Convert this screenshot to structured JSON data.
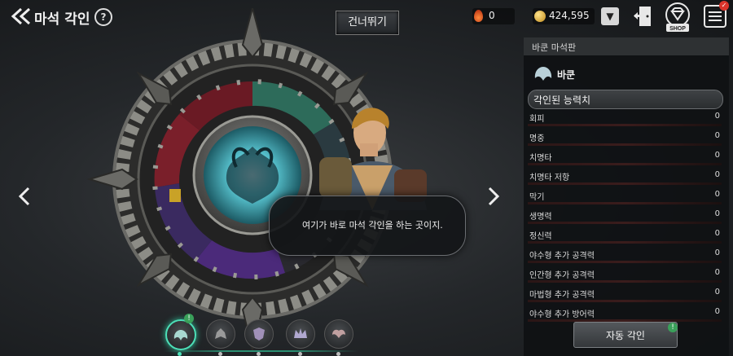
{
  "header": {
    "title": "마석 각인",
    "help_label": "?",
    "skip_label": "건너뛰기",
    "red_currency": "0",
    "gold_currency": "424,595",
    "dropdown_label": "▼",
    "shop_label": "SHOP",
    "menu_badge": "✓"
  },
  "dialog": {
    "text": "여기가 바로 마석 각인을 하는 곳이지."
  },
  "panel": {
    "title": "바쿤 마석판",
    "name": "바쿤",
    "section_title": "각인된 능력치",
    "stats": [
      {
        "label": "회피",
        "value": "0"
      },
      {
        "label": "명중",
        "value": "0"
      },
      {
        "label": "치명타",
        "value": "0"
      },
      {
        "label": "치명타 저항",
        "value": "0"
      },
      {
        "label": "막기",
        "value": "0"
      },
      {
        "label": "생명력",
        "value": "0"
      },
      {
        "label": "정신력",
        "value": "0"
      },
      {
        "label": "야수형 추가 공격력",
        "value": "0"
      },
      {
        "label": "인간형 추가 공격력",
        "value": "0"
      },
      {
        "label": "마법형 추가 공격력",
        "value": "0"
      },
      {
        "label": "야수형 추가 방어력",
        "value": "0"
      }
    ],
    "auto_label": "자동 각인",
    "auto_badge": "!"
  },
  "tabs": {
    "badge": "!"
  },
  "colors": {
    "accent": "#4de0b8",
    "badge_green": "#3aa05a",
    "badge_red": "#d9342b",
    "stat_bar": "#3a1c1c"
  }
}
